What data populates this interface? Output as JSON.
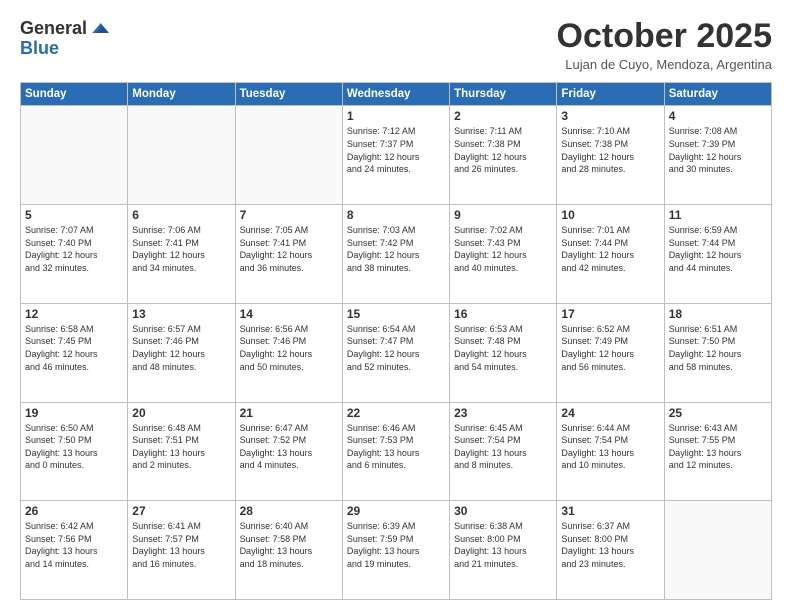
{
  "header": {
    "logo_general": "General",
    "logo_blue": "Blue",
    "month": "October 2025",
    "location": "Lujan de Cuyo, Mendoza, Argentina"
  },
  "weekdays": [
    "Sunday",
    "Monday",
    "Tuesday",
    "Wednesday",
    "Thursday",
    "Friday",
    "Saturday"
  ],
  "weeks": [
    [
      {
        "day": "",
        "info": ""
      },
      {
        "day": "",
        "info": ""
      },
      {
        "day": "",
        "info": ""
      },
      {
        "day": "1",
        "info": "Sunrise: 7:12 AM\nSunset: 7:37 PM\nDaylight: 12 hours\nand 24 minutes."
      },
      {
        "day": "2",
        "info": "Sunrise: 7:11 AM\nSunset: 7:38 PM\nDaylight: 12 hours\nand 26 minutes."
      },
      {
        "day": "3",
        "info": "Sunrise: 7:10 AM\nSunset: 7:38 PM\nDaylight: 12 hours\nand 28 minutes."
      },
      {
        "day": "4",
        "info": "Sunrise: 7:08 AM\nSunset: 7:39 PM\nDaylight: 12 hours\nand 30 minutes."
      }
    ],
    [
      {
        "day": "5",
        "info": "Sunrise: 7:07 AM\nSunset: 7:40 PM\nDaylight: 12 hours\nand 32 minutes."
      },
      {
        "day": "6",
        "info": "Sunrise: 7:06 AM\nSunset: 7:41 PM\nDaylight: 12 hours\nand 34 minutes."
      },
      {
        "day": "7",
        "info": "Sunrise: 7:05 AM\nSunset: 7:41 PM\nDaylight: 12 hours\nand 36 minutes."
      },
      {
        "day": "8",
        "info": "Sunrise: 7:03 AM\nSunset: 7:42 PM\nDaylight: 12 hours\nand 38 minutes."
      },
      {
        "day": "9",
        "info": "Sunrise: 7:02 AM\nSunset: 7:43 PM\nDaylight: 12 hours\nand 40 minutes."
      },
      {
        "day": "10",
        "info": "Sunrise: 7:01 AM\nSunset: 7:44 PM\nDaylight: 12 hours\nand 42 minutes."
      },
      {
        "day": "11",
        "info": "Sunrise: 6:59 AM\nSunset: 7:44 PM\nDaylight: 12 hours\nand 44 minutes."
      }
    ],
    [
      {
        "day": "12",
        "info": "Sunrise: 6:58 AM\nSunset: 7:45 PM\nDaylight: 12 hours\nand 46 minutes."
      },
      {
        "day": "13",
        "info": "Sunrise: 6:57 AM\nSunset: 7:46 PM\nDaylight: 12 hours\nand 48 minutes."
      },
      {
        "day": "14",
        "info": "Sunrise: 6:56 AM\nSunset: 7:46 PM\nDaylight: 12 hours\nand 50 minutes."
      },
      {
        "day": "15",
        "info": "Sunrise: 6:54 AM\nSunset: 7:47 PM\nDaylight: 12 hours\nand 52 minutes."
      },
      {
        "day": "16",
        "info": "Sunrise: 6:53 AM\nSunset: 7:48 PM\nDaylight: 12 hours\nand 54 minutes."
      },
      {
        "day": "17",
        "info": "Sunrise: 6:52 AM\nSunset: 7:49 PM\nDaylight: 12 hours\nand 56 minutes."
      },
      {
        "day": "18",
        "info": "Sunrise: 6:51 AM\nSunset: 7:50 PM\nDaylight: 12 hours\nand 58 minutes."
      }
    ],
    [
      {
        "day": "19",
        "info": "Sunrise: 6:50 AM\nSunset: 7:50 PM\nDaylight: 13 hours\nand 0 minutes."
      },
      {
        "day": "20",
        "info": "Sunrise: 6:48 AM\nSunset: 7:51 PM\nDaylight: 13 hours\nand 2 minutes."
      },
      {
        "day": "21",
        "info": "Sunrise: 6:47 AM\nSunset: 7:52 PM\nDaylight: 13 hours\nand 4 minutes."
      },
      {
        "day": "22",
        "info": "Sunrise: 6:46 AM\nSunset: 7:53 PM\nDaylight: 13 hours\nand 6 minutes."
      },
      {
        "day": "23",
        "info": "Sunrise: 6:45 AM\nSunset: 7:54 PM\nDaylight: 13 hours\nand 8 minutes."
      },
      {
        "day": "24",
        "info": "Sunrise: 6:44 AM\nSunset: 7:54 PM\nDaylight: 13 hours\nand 10 minutes."
      },
      {
        "day": "25",
        "info": "Sunrise: 6:43 AM\nSunset: 7:55 PM\nDaylight: 13 hours\nand 12 minutes."
      }
    ],
    [
      {
        "day": "26",
        "info": "Sunrise: 6:42 AM\nSunset: 7:56 PM\nDaylight: 13 hours\nand 14 minutes."
      },
      {
        "day": "27",
        "info": "Sunrise: 6:41 AM\nSunset: 7:57 PM\nDaylight: 13 hours\nand 16 minutes."
      },
      {
        "day": "28",
        "info": "Sunrise: 6:40 AM\nSunset: 7:58 PM\nDaylight: 13 hours\nand 18 minutes."
      },
      {
        "day": "29",
        "info": "Sunrise: 6:39 AM\nSunset: 7:59 PM\nDaylight: 13 hours\nand 19 minutes."
      },
      {
        "day": "30",
        "info": "Sunrise: 6:38 AM\nSunset: 8:00 PM\nDaylight: 13 hours\nand 21 minutes."
      },
      {
        "day": "31",
        "info": "Sunrise: 6:37 AM\nSunset: 8:00 PM\nDaylight: 13 hours\nand 23 minutes."
      },
      {
        "day": "",
        "info": ""
      }
    ]
  ]
}
